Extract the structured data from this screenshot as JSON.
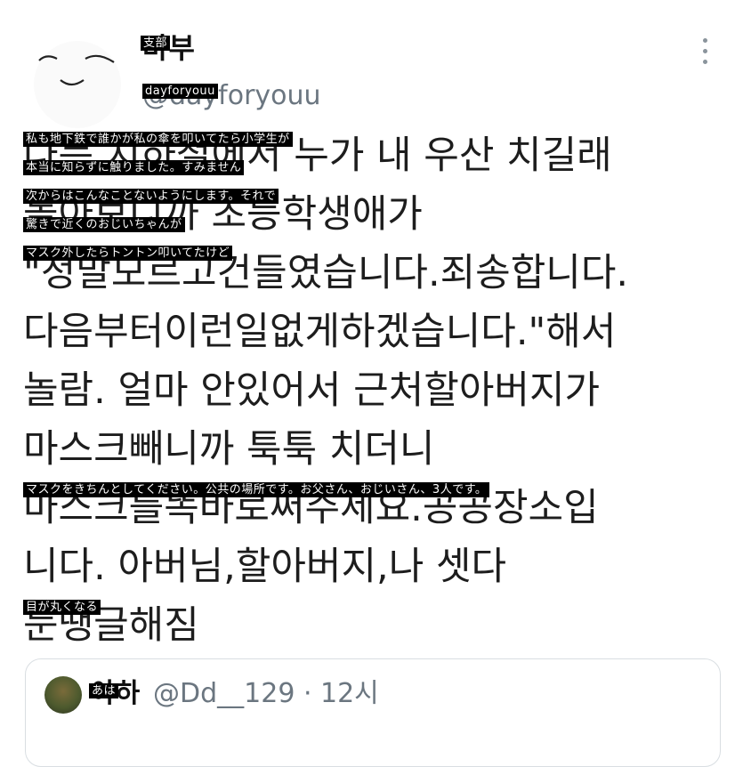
{
  "tweet": {
    "author_name": "바부",
    "author_handle": "@dayforyouu",
    "body_lines": [
      "나는 지하철에서 누가 내 우산 치길래",
      "돌아보니까 초등학생애가",
      "\"정말모르고건들였습니다.죄송합니다.",
      "다음부터이런일없게하겠습니다.\"해서",
      "놀람. 얼마 안있어서 근처할아버지가",
      "마스크빼니까 툭툭 치더니",
      "마스크를똑바로써주세요.공공장소입",
      "니다. 아버님,할아버지,나 셋다",
      "눈땡글해짐"
    ]
  },
  "captions": {
    "name": "支部",
    "handle": "dayforyouu",
    "line1": "私も地下鉄で誰かが私の傘を叩いてたら小学生が",
    "line2": "本当に知らずに触りました。すみません",
    "line3": "次からはこんなことないようにします。それで",
    "line4": "驚きで近くのおじいちゃんが",
    "line5": "マスク外したらトントン叩いてたけど",
    "line6": "マスクをきちんとしてください。公共の場所です。お父さん、おじいさん、3人です。",
    "line7": "目が丸くなる",
    "quote_name": "あは"
  },
  "quoted_tweet": {
    "author_name": "아하",
    "author_handle": "@Dd__129 · 12시"
  }
}
